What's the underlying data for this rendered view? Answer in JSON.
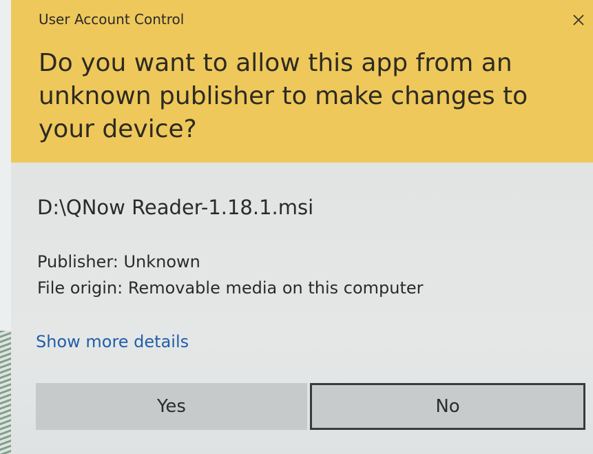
{
  "window": {
    "title": "User Account Control",
    "close_icon": "close-icon"
  },
  "prompt": {
    "question": "Do you want to allow this app from an unknown publisher to make changes to your device?"
  },
  "app": {
    "file_path": "D:\\QNow Reader-1.18.1.msi",
    "publisher": "Publisher: Unknown",
    "file_origin": "File origin: Removable media on this computer"
  },
  "links": {
    "show_details": "Show more details"
  },
  "buttons": {
    "yes": "Yes",
    "no": "No"
  },
  "colors": {
    "header_bg": "#eec85a",
    "link": "#1f5fa8",
    "body_bg": "#e3e5e5"
  }
}
